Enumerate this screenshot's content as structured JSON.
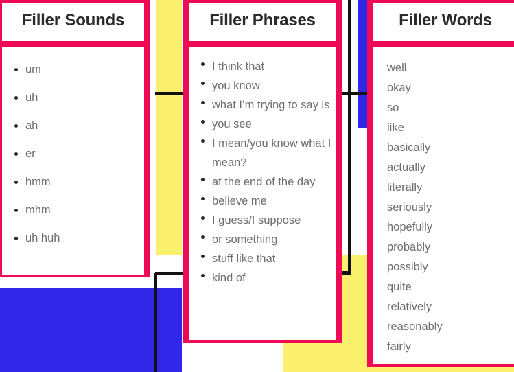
{
  "colors": {
    "accent_pink": "#EE0A55",
    "accent_blue": "#3226E8",
    "accent_yellow": "#FAF06E",
    "rule_black": "#111111",
    "card_background": "#FFFFFF",
    "title_text": "#2B2B2B",
    "item_text": "#6E6E6E"
  },
  "cards": [
    {
      "title": "Filler Sounds",
      "bulleted": true,
      "items": [
        "um",
        "uh",
        "ah",
        "er",
        "hmm",
        "mhm",
        "uh huh"
      ]
    },
    {
      "title": "Filler Phrases",
      "bulleted": true,
      "items": [
        "I think that",
        "you know",
        "what I’m trying to say is",
        "you see",
        "I mean/you know what I mean?",
        "at the end of the day",
        "believe me",
        "I guess/I suppose",
        "or something",
        "stuff like that",
        "kind of"
      ]
    },
    {
      "title": "Filler Words",
      "bulleted": false,
      "items": [
        "well",
        "okay",
        "so",
        "like",
        "basically",
        "actually",
        "literally",
        "seriously",
        "hopefully",
        "probably",
        "possibly",
        "quite",
        "relatively",
        "reasonably",
        "fairly"
      ]
    }
  ]
}
